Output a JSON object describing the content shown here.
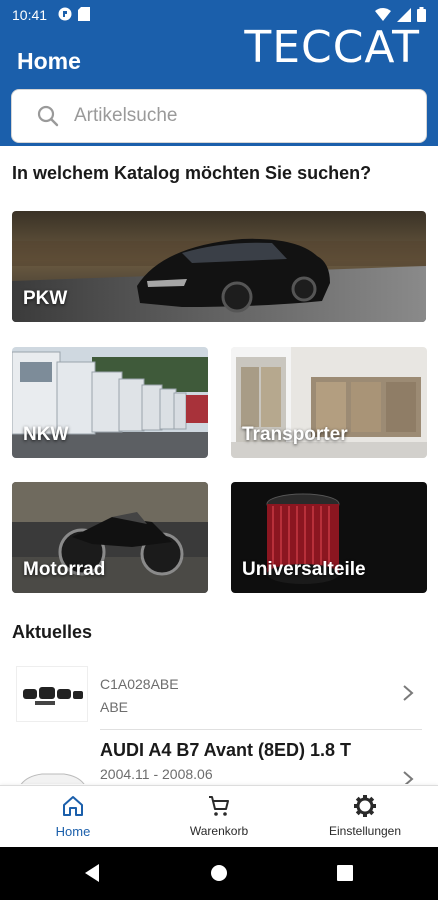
{
  "status": {
    "time": "10:41"
  },
  "header": {
    "brand": "TECCAT",
    "title": "Home"
  },
  "search": {
    "placeholder": "Artikelsuche"
  },
  "catalog_question": "In welchem Katalog möchten Sie suchen?",
  "catalogs": [
    {
      "label": "PKW"
    },
    {
      "label": "NKW"
    },
    {
      "label": "Transporter"
    },
    {
      "label": "Motorrad"
    },
    {
      "label": "Universalteile"
    }
  ],
  "news": {
    "title": "Aktuelles",
    "items": [
      {
        "line1": "C1A028ABE",
        "line2": "ABE"
      },
      {
        "line1": "AUDI A4 B7 Avant (8ED) 1.8 T",
        "line2": "2004.11 - 2008.06"
      }
    ]
  },
  "nav": [
    {
      "label": "Home"
    },
    {
      "label": "Warenkorb"
    },
    {
      "label": "Einstellungen"
    }
  ],
  "colors": {
    "accent": "#1b5fab"
  }
}
